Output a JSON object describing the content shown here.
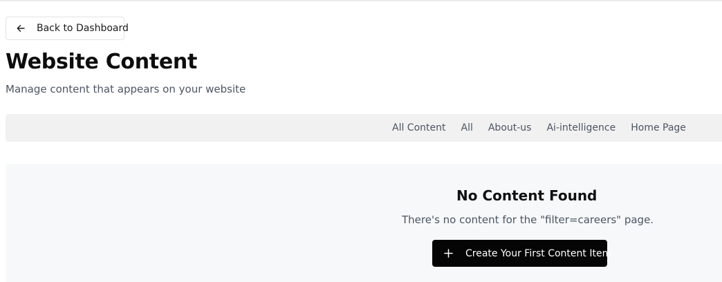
{
  "header": {
    "back_label": "Back to Dashboard",
    "back_icon": "arrow-left-icon"
  },
  "page": {
    "title": "Website Content",
    "subtitle": "Manage content that appears on your website"
  },
  "filters": {
    "tabs": [
      {
        "label": "All Content"
      },
      {
        "label": "All"
      },
      {
        "label": "About-us"
      },
      {
        "label": "Ai-intelligence"
      },
      {
        "label": "Home Page"
      }
    ]
  },
  "empty_state": {
    "title": "No Content Found",
    "message": "There's no content for the \"filter=careers\" page.",
    "create_label": "Create Your First Content Item",
    "create_icon": "plus-icon"
  },
  "colors": {
    "primary_button": "#050505",
    "filter_bar_bg": "#f1f1f1",
    "panel_bg": "#f7f8fa",
    "muted_text": "#4b5563"
  }
}
